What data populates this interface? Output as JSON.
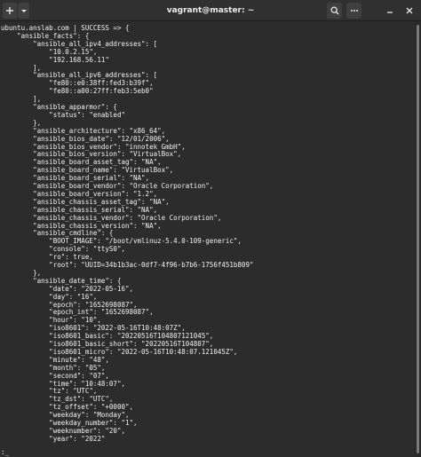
{
  "window": {
    "title": "vagrant@master: ~",
    "icons": {
      "new_tab": "plus-icon",
      "tab_menu": "chevron-down-icon",
      "search": "search-icon",
      "menu": "ellipsis-icon",
      "minimize": "minimize-icon",
      "close": "close-icon"
    }
  },
  "terminal": {
    "lines": [
      "ubuntu.anslab.com | SUCCESS => {",
      "    \"ansible_facts\": {",
      "        \"ansible_all_ipv4_addresses\": [",
      "            \"10.0.2.15\",",
      "            \"192.168.56.11\"",
      "        ],",
      "        \"ansible_all_ipv6_addresses\": [",
      "            \"fe80::e0:38ff:fed3:b39f\",",
      "            \"fe80::a00:27ff:feb3:5eb0\"",
      "        ],",
      "        \"ansible_apparmor\": {",
      "            \"status\": \"enabled\"",
      "        },",
      "        \"ansible_architecture\": \"x86_64\",",
      "        \"ansible_bios_date\": \"12/01/2006\",",
      "        \"ansible_bios_vendor\": \"innotek GmbH\",",
      "        \"ansible_bios_version\": \"VirtualBox\",",
      "        \"ansible_board_asset_tag\": \"NA\",",
      "        \"ansible_board_name\": \"VirtualBox\",",
      "        \"ansible_board_serial\": \"NA\",",
      "        \"ansible_board_vendor\": \"Oracle Corporation\",",
      "        \"ansible_board_version\": \"1.2\",",
      "        \"ansible_chassis_asset_tag\": \"NA\",",
      "        \"ansible_chassis_serial\": \"NA\",",
      "        \"ansible_chassis_vendor\": \"Oracle Corporation\",",
      "        \"ansible_chassis_version\": \"NA\",",
      "        \"ansible_cmdline\": {",
      "            \"BOOT_IMAGE\": \"/boot/vmlinuz-5.4.0-109-generic\",",
      "            \"console\": \"ttyS0\",",
      "            \"ro\": true,",
      "            \"root\": \"UUID=34b1b3ac-0df7-4f96-b7b6-1756f451b809\"",
      "        },",
      "        \"ansible_date_time\": {",
      "            \"date\": \"2022-05-16\",",
      "            \"day\": \"16\",",
      "            \"epoch\": \"1652698087\",",
      "            \"epoch_int\": \"1652698087\",",
      "            \"hour\": \"10\",",
      "            \"iso8601\": \"2022-05-16T10:48:07Z\",",
      "            \"iso8601_basic\": \"20220516T104807121045\",",
      "            \"iso8601_basic_short\": \"20220516T104807\",",
      "            \"iso8601_micro\": \"2022-05-16T10:48:07.121045Z\",",
      "            \"minute\": \"48\",",
      "            \"month\": \"05\",",
      "            \"second\": \"07\",",
      "            \"time\": \"10:48:07\",",
      "            \"tz\": \"UTC\",",
      "            \"tz_dst\": \"UTC\",",
      "            \"tz_offset\": \"+0000\",",
      "            \"weekday\": \"Monday\",",
      "            \"weekday_number\": \"1\",",
      "            \"weeknumber\": \"20\",",
      "            \"year\": \"2022\""
    ],
    "cursor": ":_"
  }
}
